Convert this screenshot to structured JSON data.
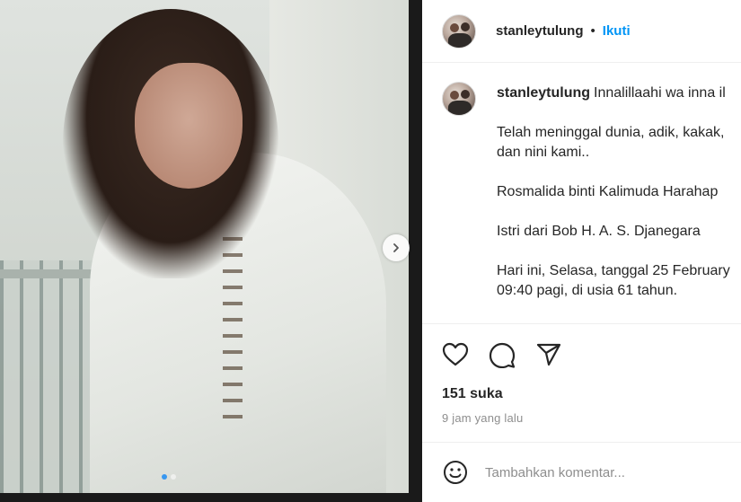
{
  "post": {
    "slide_dots": 2,
    "active_slide": 1
  },
  "header": {
    "username": "stanleytulung",
    "separator": "•",
    "follow_label": "Ikuti"
  },
  "caption": {
    "username": "stanleytulung",
    "lines": [
      "Innalillaahi wa inna il",
      "Telah meninggal dunia, adik, kakak,",
      "dan nini kami..",
      "Rosmalida binti Kalimuda Harahap",
      "Istri dari Bob H. A. S. Djanegara",
      "Hari ini, Selasa, tanggal 25 February",
      "09:40 pagi, di usia 61 tahun."
    ]
  },
  "actions": {
    "like_icon": "heart-icon",
    "comment_icon": "comment-bubble-icon",
    "share_icon": "paper-plane-icon"
  },
  "likes_label": "151 suka",
  "timestamp": "9 jam yang lalu",
  "comment": {
    "placeholder": "Tambahkan komentar...",
    "emoji_icon": "smiley-icon"
  },
  "colors": {
    "link_blue": "#0095f6",
    "muted_text": "#8e8e8e",
    "divider": "#efefef"
  }
}
